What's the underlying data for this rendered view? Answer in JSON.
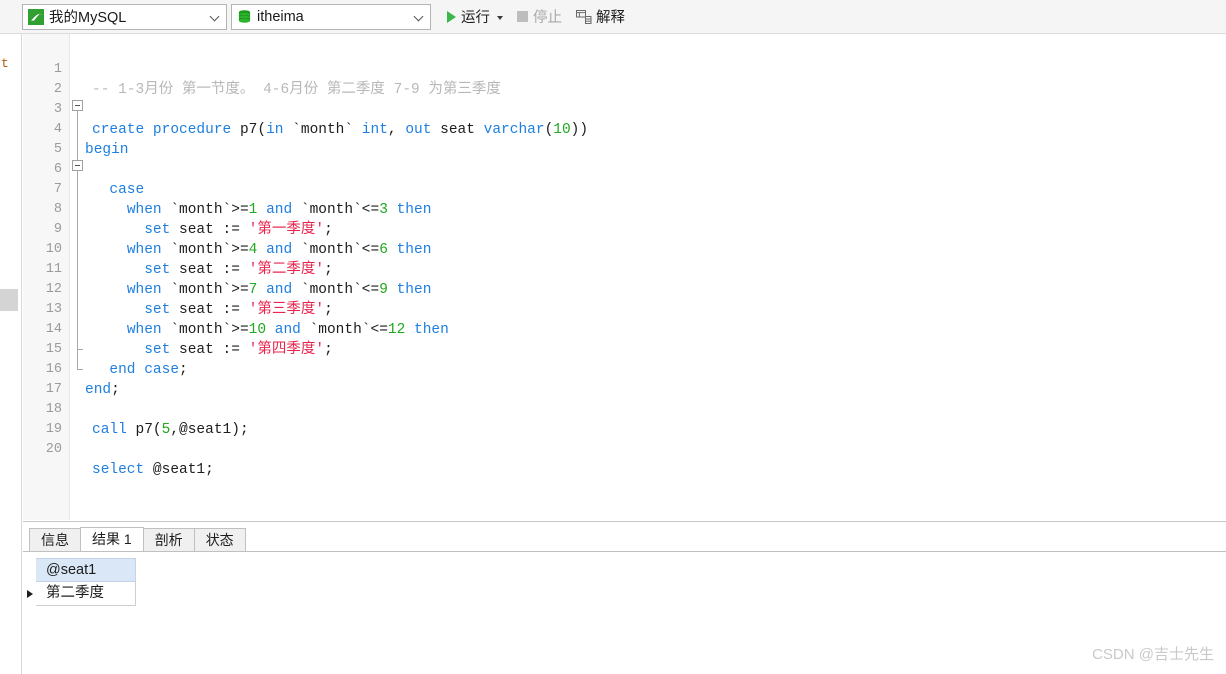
{
  "toolbar": {
    "connection": {
      "label": "我的MySQL",
      "icon": "mysql-dolphin-icon",
      "accent": "#30a030"
    },
    "database": {
      "label": "itheima",
      "icon": "database-cylinder-icon",
      "accent": "#1a9b1a"
    },
    "run": {
      "label": "运行",
      "icon": "play-icon",
      "enabled": true,
      "accent": "#3cb54a"
    },
    "stop": {
      "label": "停止",
      "icon": "stop-square-icon",
      "enabled": false
    },
    "explain": {
      "label": "解释",
      "icon": "explain-icon",
      "enabled": true
    }
  },
  "left_rail": {
    "partial_text": "t"
  },
  "editor": {
    "line_count": 20,
    "colors": {
      "keyword": "#1f7fe0",
      "plain": "#1d1d1d",
      "number": "#1fa81f",
      "string": "#e8254f",
      "comment": "#b8b8b8"
    },
    "lines": [
      {
        "n": "1",
        "text": "-- 1-3月份 第一节度。 4-6月份 第二季度 7-9 为第三季度"
      },
      {
        "n": "2",
        "text": ""
      },
      {
        "n": "3",
        "text": "create procedure p7(in `month` int, out seat varchar(10))"
      },
      {
        "n": "4",
        "text": "begin"
      },
      {
        "n": "5",
        "text": ""
      },
      {
        "n": "6",
        "text": "  case"
      },
      {
        "n": "7",
        "text": "    when `month`>=1 and `month`<=3 then"
      },
      {
        "n": "8",
        "text": "      set seat := '第一季度';"
      },
      {
        "n": "9",
        "text": "    when `month`>=4 and `month`<=6 then"
      },
      {
        "n": "10",
        "text": "      set seat := '第二季度';"
      },
      {
        "n": "11",
        "text": "    when `month`>=7 and `month`<=9 then"
      },
      {
        "n": "12",
        "text": "      set seat := '第三季度';"
      },
      {
        "n": "13",
        "text": "    when `month`>=10 and `month`<=12 then"
      },
      {
        "n": "14",
        "text": "      set seat := '第四季度';"
      },
      {
        "n": "15",
        "text": "  end case;"
      },
      {
        "n": "16",
        "text": "end;"
      },
      {
        "n": "17",
        "text": ""
      },
      {
        "n": "18",
        "text": "call p7(5,@seat1);"
      },
      {
        "n": "19",
        "text": ""
      },
      {
        "n": "20",
        "text": "select @seat1;"
      }
    ]
  },
  "results": {
    "tabs": [
      {
        "label": "信息",
        "active": false
      },
      {
        "label": "结果 1",
        "active": true
      },
      {
        "label": "剖析",
        "active": false
      },
      {
        "label": "状态",
        "active": false
      }
    ],
    "grid": {
      "columns": [
        "@seat1"
      ],
      "rows": [
        {
          "current": true,
          "cells": [
            "第二季度"
          ]
        }
      ]
    }
  },
  "watermark": "CSDN @吉士先生"
}
